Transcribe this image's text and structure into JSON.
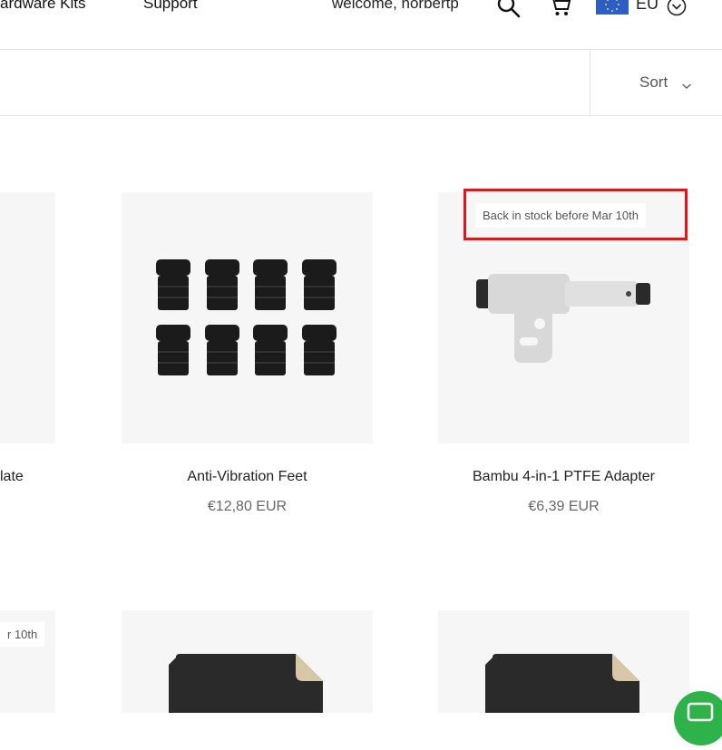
{
  "header": {
    "nav": [
      {
        "label": "ardware Kits"
      },
      {
        "label": "Support"
      }
    ],
    "welcome": "welcome, norbertp",
    "icons": [
      "search-icon",
      "cart-icon",
      "eu-flag-icon",
      "chevron-down-icon"
    ],
    "region_label": "EU"
  },
  "toolbar": {
    "sort_label": "Sort"
  },
  "products": [
    {
      "title": "late",
      "price": ""
    },
    {
      "title": "Anti-Vibration Feet",
      "price": "€12,80 EUR"
    },
    {
      "title": "Bambu 4-in-1 PTFE Adapter",
      "price": "€6,39 EUR",
      "badge": "Back in stock before Mar 10th"
    },
    {
      "title": "",
      "price": "",
      "badge": "r 10th"
    },
    {
      "title": "",
      "price": ""
    },
    {
      "title": "",
      "price": ""
    }
  ],
  "colors": {
    "highlight": "#ee1111",
    "chat": "#2db34a",
    "flag": "#2b5fc7"
  }
}
